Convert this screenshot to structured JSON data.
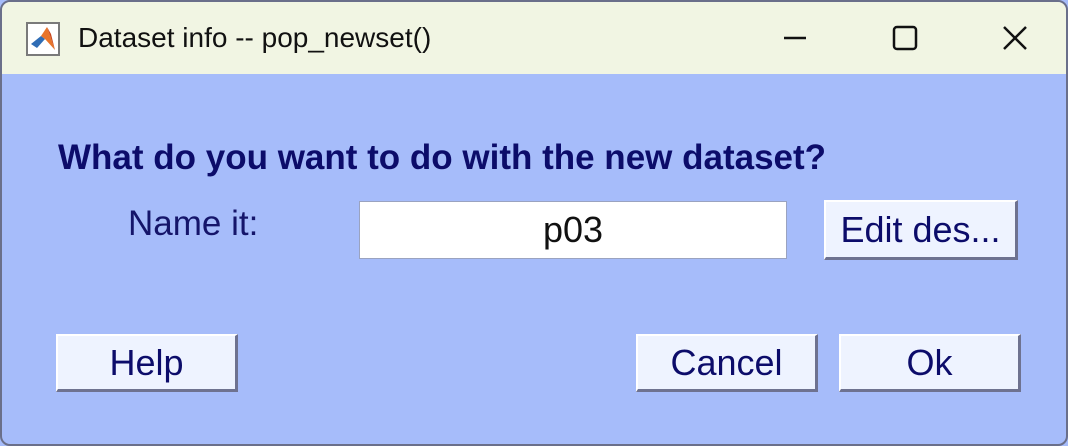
{
  "window": {
    "title": "Dataset info -- pop_newset()",
    "app_icon": "matlab-logo-icon",
    "controls": {
      "minimize_icon": "minimize-icon",
      "maximize_icon": "maximize-icon",
      "close_icon": "close-icon"
    }
  },
  "dialog": {
    "question": "What do you want to do with the new dataset?",
    "name_label": "Name it:",
    "name_value": "p03",
    "edit_description_label": "Edit des...",
    "help_label": "Help",
    "cancel_label": "Cancel",
    "ok_label": "Ok"
  },
  "colors": {
    "background": "#a6bcfa",
    "titlebar": "#f1f5e3",
    "text_dark_blue": "#0c0c6a",
    "button_face": "#eef3ff"
  }
}
